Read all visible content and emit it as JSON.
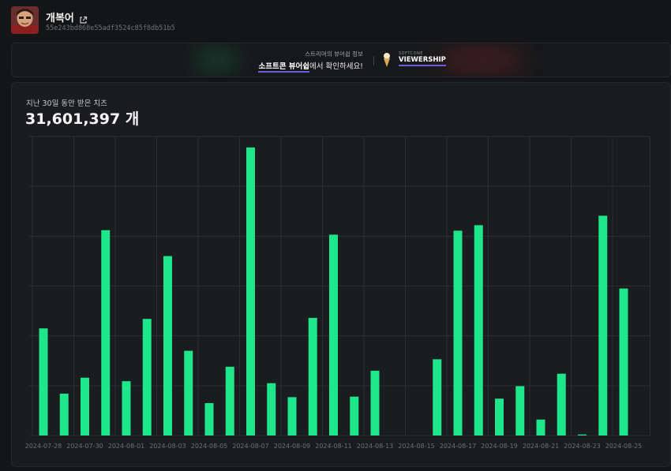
{
  "channel": {
    "name": "개복어",
    "id": "55e243bd868e55adf3524c85f8db51b5",
    "external_icon": "external-link-icon"
  },
  "banner": {
    "line1": "스트리머의 뷰어쉽 정보",
    "line2_highlight": "소프트콘 뷰어쉽",
    "line2_rest": "에서 확인하세요!",
    "brand_small": "SOFTCONE",
    "brand_name": "VIEWERSHIP",
    "accent": "#6e5bd9"
  },
  "stats": {
    "label": "지난 30일 동안 받은 치즈",
    "total": "31,601,397 개"
  },
  "colors": {
    "bar": "#1ee68a",
    "grid": "#2c2e33",
    "tick_text": "#6c7076"
  },
  "chart_data": {
    "type": "bar",
    "title": "",
    "xlabel": "",
    "ylabel": "",
    "ylim": [
      0,
      6
    ],
    "grid": true,
    "x_tick_labels": [
      "2024-07-28",
      "2024-07-30",
      "2024-08-01",
      "2024-08-03",
      "2024-08-05",
      "2024-08-07",
      "2024-08-09",
      "2024-08-11",
      "2024-08-13",
      "2024-08-15",
      "2024-08-17",
      "2024-08-19",
      "2024-08-21",
      "2024-08-23",
      "2024-08-25"
    ],
    "categories": [
      "2024-07-28",
      "2024-07-29",
      "2024-07-30",
      "2024-07-31",
      "2024-08-01",
      "2024-08-02",
      "2024-08-03",
      "2024-08-04",
      "2024-08-05",
      "2024-08-06",
      "2024-08-07",
      "2024-08-08",
      "2024-08-09",
      "2024-08-10",
      "2024-08-11",
      "2024-08-12",
      "2024-08-13",
      "2024-08-14",
      "2024-08-15",
      "2024-08-16",
      "2024-08-17",
      "2024-08-18",
      "2024-08-19",
      "2024-08-20",
      "2024-08-21",
      "2024-08-22",
      "2024-08-23",
      "2024-08-24",
      "2024-08-25",
      "2024-08-26"
    ],
    "values": [
      2.15,
      0.84,
      1.16,
      4.12,
      1.09,
      2.34,
      3.6,
      1.7,
      0.65,
      1.38,
      5.78,
      1.05,
      0.77,
      2.36,
      4.03,
      0.78,
      1.3,
      0,
      0,
      1.53,
      4.11,
      4.22,
      0.74,
      0.99,
      0.32,
      1.24,
      0.02,
      4.41,
      2.95,
      0
    ]
  }
}
